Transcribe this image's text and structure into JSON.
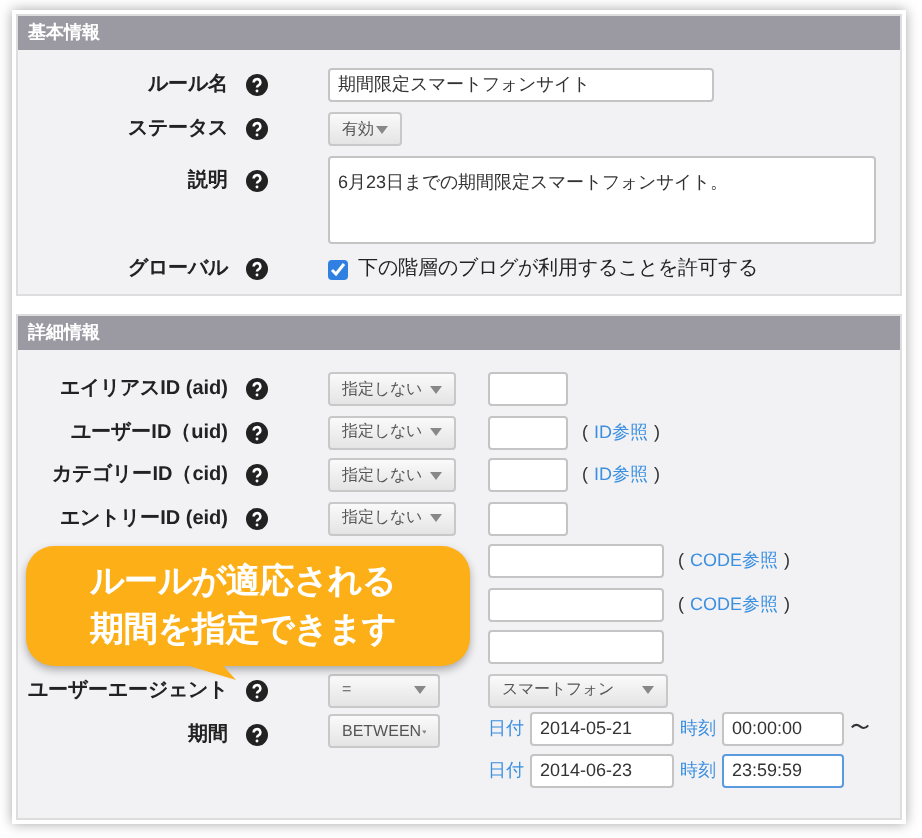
{
  "basic": {
    "title": "基本情報",
    "rows": [
      {
        "kind": "text",
        "label": "ルール名",
        "value": "期間限定スマートフォンサイト"
      },
      {
        "kind": "select",
        "label": "ステータス",
        "value": "有効"
      },
      {
        "kind": "textarea",
        "label": "説明",
        "value": "6月23日までの期間限定スマートフォンサイト。"
      },
      {
        "kind": "checkbox",
        "label": "グローバル",
        "checked": true,
        "text": "下の階層のブログが利用することを許可する"
      }
    ]
  },
  "detail": {
    "title": "詳細情報",
    "rows": [
      {
        "label": "エイリアスID (aid)",
        "operator": "指定しない",
        "kind": "short"
      },
      {
        "label": "ユーザーID（uid)",
        "operator": "指定しない",
        "kind": "short",
        "link": {
          "open": "(",
          "text": "ID参照",
          "close": ")"
        }
      },
      {
        "label": "カテゴリーID（cid)",
        "operator": "指定しない",
        "kind": "short",
        "link": {
          "open": "(",
          "text": "ID参照",
          "close": ")"
        }
      },
      {
        "label": "エントリーID (eid)",
        "operator": "指定しない",
        "kind": "short"
      },
      {
        "kind": "wide",
        "link": {
          "open": "(",
          "text": "CODE参照",
          "close": ")"
        }
      },
      {
        "kind": "wide",
        "link": {
          "open": "(",
          "text": "CODE参照",
          "close": ")"
        }
      },
      {
        "kind": "wide"
      },
      {
        "label": "ユーザーエージェント",
        "operator": "=",
        "kind": "select",
        "value": "スマートフォン"
      }
    ],
    "period": {
      "label": "期間",
      "operator": "BETWEEN",
      "ranges": [
        {
          "date_label": "日付",
          "date": "2014-05-21",
          "time_label": "時刻",
          "time": "00:00:00",
          "suffix": "〜",
          "focused": false
        },
        {
          "date_label": "日付",
          "date": "2014-06-23",
          "time_label": "時刻",
          "time": "23:59:59",
          "focused": true
        }
      ]
    }
  },
  "callout": {
    "lines": [
      "ルールが適応される",
      "期間を指定できます"
    ]
  }
}
